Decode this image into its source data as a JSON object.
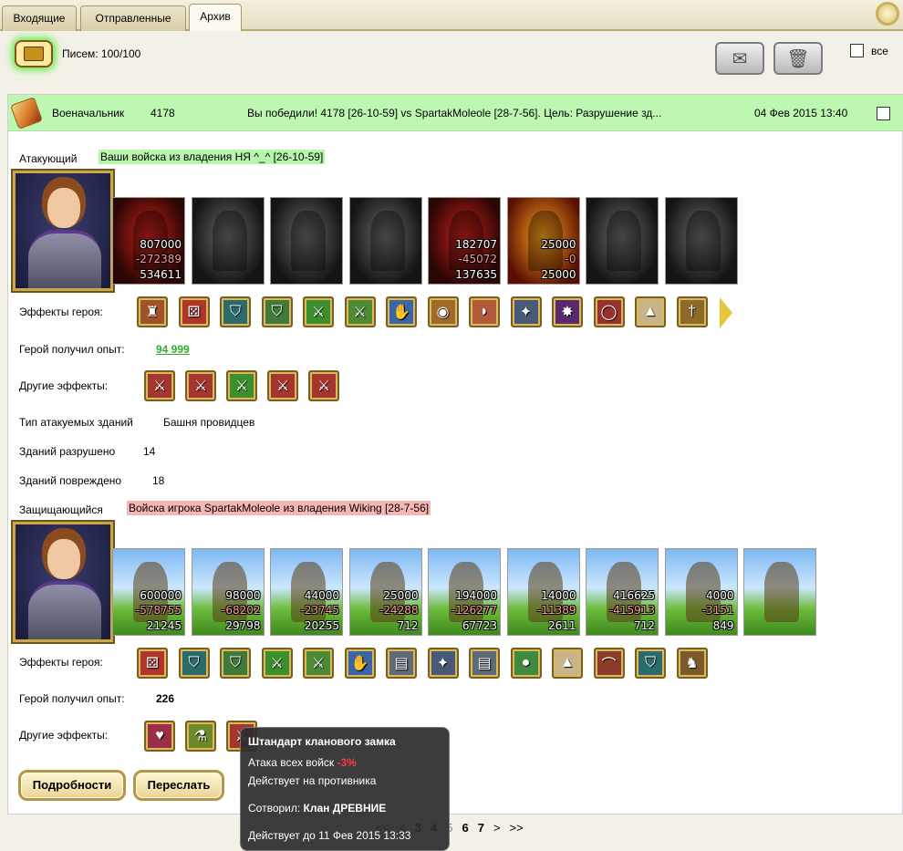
{
  "tabs": [
    {
      "label": "Входящие",
      "active": false
    },
    {
      "label": "Отправленные",
      "active": false
    },
    {
      "label": "Архив",
      "active": true
    }
  ],
  "toolbar": {
    "folder_icon": "folder-icon",
    "count_label": "Писем: 100/100",
    "envelope_icon": "envelope-icon",
    "trash_icon": "trash-icon",
    "select_all_label": "все"
  },
  "message": {
    "icon": "sword-icon",
    "sender": "Военачальник",
    "sender_id": "4178",
    "subject": "Вы победили! 4178 [26-10-59] vs SpartakMoleole [28-7-56]. Цель: Разрушение зд...",
    "date": "04 Фев 2015 13:40",
    "attacker": {
      "label": "Атакующий",
      "value": "Ваши войска из владения НЯ ^_^ [26-10-59]",
      "units": [
        {
          "style": "red",
          "n1": "807000",
          "n2": "-272389",
          "n3": "534611"
        },
        {
          "style": "dark",
          "n1": "",
          "n2": "",
          "n3": ""
        },
        {
          "style": "dark",
          "n1": "",
          "n2": "",
          "n3": ""
        },
        {
          "style": "dark",
          "n1": "",
          "n2": "",
          "n3": ""
        },
        {
          "style": "red",
          "n1": "182707",
          "n2": "-45072",
          "n3": "137635"
        },
        {
          "style": "fire",
          "n1": "25000",
          "n2": "-0",
          "n3": "25000"
        },
        {
          "style": "dark",
          "n1": "",
          "n2": "",
          "n3": ""
        },
        {
          "style": "dark",
          "n1": "",
          "n2": "",
          "n3": ""
        }
      ],
      "effects_label": "Эффекты героя:",
      "effects": [
        "tower-icon",
        "dice-icon",
        "shield-icon",
        "handshake-shield-icon",
        "sword-icon",
        "handshake-sword-icon",
        "crystal-hand-icon",
        "bag-icon",
        "horn-icon",
        "amulet-icon",
        "spider-icon",
        "ring-icon",
        "tent-icon",
        "dagger-icon"
      ],
      "exp_label": "Герой получил опыт:",
      "exp_value": "94 999",
      "other_label": "Другие эффекты:",
      "other_effects": [
        "fist-sword-icon",
        "fist-sword-icon",
        "sword-icon",
        "fist-sword-icon",
        "fist-sword-icon"
      ],
      "target_label": "Тип атакуемых зданий",
      "target_value": "Башня провидцев",
      "destroyed_label": "Зданий разрушено",
      "destroyed_value": "14",
      "damaged_label": "Зданий повреждено",
      "damaged_value": "18"
    },
    "defender": {
      "label": "Защищающийся",
      "value": "Войска игрока SpartakMoleole из владения Wiking [28-7-56]",
      "units": [
        {
          "n1": "600000",
          "n2": "-578755",
          "n3": "21245"
        },
        {
          "n1": "98000",
          "n2": "-68202",
          "n3": "29798"
        },
        {
          "n1": "44000",
          "n2": "-23745",
          "n3": "20255"
        },
        {
          "n1": "25000",
          "n2": "-24288",
          "n3": "712"
        },
        {
          "n1": "194000",
          "n2": "-126277",
          "n3": "67723"
        },
        {
          "n1": "14000",
          "n2": "-11389",
          "n3": "2611"
        },
        {
          "n1": "416625",
          "n2": "-415913",
          "n3": "712"
        },
        {
          "n1": "4000",
          "n2": "-3151",
          "n3": "849"
        },
        {
          "n1": "",
          "n2": "",
          "n3": ""
        }
      ],
      "effects_label": "Эффекты героя:",
      "effects": [
        "dice-icon",
        "shield-icon",
        "handshake-shield-icon",
        "sword-icon",
        "handshake-sword-icon",
        "crystal-hand-icon",
        "barrel-icon",
        "amulet-icon",
        "barrel-icon",
        "orb-icon",
        "tent-icon",
        "bow-icon",
        "shield-icon",
        "warrior-icon"
      ],
      "exp_label": "Герой получил опыт:",
      "exp_value": "226",
      "other_label": "Другие эффекты:",
      "other_effects": [
        "heart-sword-icon",
        "flask-icon",
        "fist-sword-icon"
      ]
    }
  },
  "buttons": {
    "details": "Подробности",
    "forward": "Переслать"
  },
  "pager": {
    "items": [
      "<<",
      "<",
      "3",
      "4",
      "5",
      "6",
      "7",
      ">",
      ">>"
    ],
    "current": "5"
  },
  "tooltip": {
    "title": "Штандарт кланового замка",
    "line1_prefix": "Атака всех войск",
    "line1_value": "-3%",
    "line2": "Действует на противника",
    "author_label": "Сотворил:",
    "author_value": "Клан ДРЕВНИЕ",
    "until": "Действует до 11 Фев 2015 13:33"
  }
}
